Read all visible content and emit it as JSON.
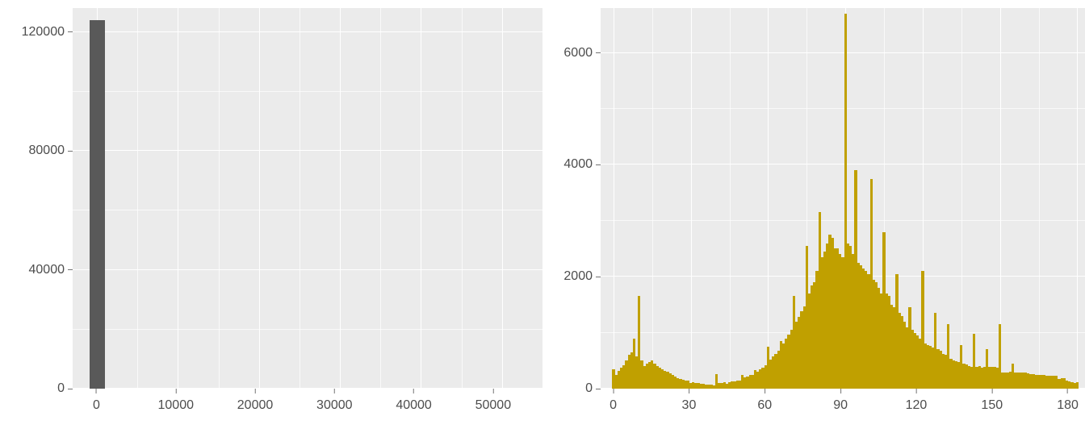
{
  "chart_data": [
    {
      "type": "bar",
      "title": "",
      "xlabel": "",
      "ylabel": "",
      "xlim": [
        -3000,
        55000
      ],
      "ylim": [
        0,
        128000
      ],
      "x_ticks": [
        0,
        10000,
        20000,
        30000,
        40000,
        50000
      ],
      "y_ticks": [
        0,
        40000,
        80000,
        120000
      ],
      "binwidth": 1900,
      "color": "#595959",
      "categories": [
        0
      ],
      "values": [
        124000
      ]
    },
    {
      "type": "bar",
      "title": "",
      "xlabel": "",
      "ylabel": "",
      "xlim": [
        -5,
        183
      ],
      "ylim": [
        0,
        6800
      ],
      "x_ticks": [
        0,
        30,
        60,
        90,
        120,
        150,
        180
      ],
      "y_ticks": [
        0,
        2000,
        4000,
        6000
      ],
      "binwidth": 1,
      "color": "#c0a000",
      "x": [
        0,
        1,
        2,
        3,
        4,
        5,
        6,
        7,
        8,
        9,
        10,
        11,
        12,
        13,
        14,
        15,
        16,
        17,
        18,
        19,
        20,
        21,
        22,
        23,
        24,
        25,
        26,
        27,
        28,
        29,
        30,
        31,
        32,
        33,
        34,
        35,
        36,
        37,
        38,
        39,
        40,
        41,
        42,
        43,
        44,
        45,
        46,
        47,
        48,
        49,
        50,
        51,
        52,
        53,
        54,
        55,
        56,
        57,
        58,
        59,
        60,
        61,
        62,
        63,
        64,
        65,
        66,
        67,
        68,
        69,
        70,
        71,
        72,
        73,
        74,
        75,
        76,
        77,
        78,
        79,
        80,
        81,
        82,
        83,
        84,
        85,
        86,
        87,
        88,
        89,
        90,
        91,
        92,
        93,
        94,
        95,
        96,
        97,
        98,
        99,
        100,
        101,
        102,
        103,
        104,
        105,
        106,
        107,
        108,
        109,
        110,
        111,
        112,
        113,
        114,
        115,
        116,
        117,
        118,
        119,
        120,
        121,
        122,
        123,
        124,
        125,
        126,
        127,
        128,
        129,
        130,
        131,
        132,
        133,
        134,
        135,
        136,
        137,
        138,
        139,
        140,
        141,
        142,
        143,
        144,
        145,
        146,
        147,
        148,
        149,
        150,
        151,
        152,
        153,
        154,
        155,
        156,
        157,
        158,
        159,
        160,
        161,
        162,
        163,
        164,
        165,
        166,
        167,
        168,
        169,
        170,
        171,
        172,
        173,
        174,
        175,
        176,
        177,
        178,
        179,
        180
      ],
      "values": [
        350,
        250,
        320,
        380,
        420,
        500,
        600,
        650,
        900,
        580,
        1650,
        500,
        400,
        450,
        480,
        500,
        450,
        400,
        380,
        350,
        320,
        300,
        280,
        240,
        210,
        190,
        180,
        160,
        150,
        140,
        100,
        110,
        105,
        95,
        90,
        80,
        70,
        75,
        70,
        65,
        260,
        100,
        105,
        110,
        90,
        120,
        125,
        130,
        140,
        150,
        250,
        200,
        220,
        240,
        250,
        330,
        300,
        350,
        380,
        420,
        750,
        520,
        580,
        620,
        680,
        850,
        800,
        900,
        960,
        1050,
        1650,
        1200,
        1280,
        1380,
        1470,
        2550,
        1700,
        1850,
        1900,
        2100,
        3150,
        2350,
        2450,
        2600,
        2750,
        2700,
        2500,
        2500,
        2400,
        2350,
        6700,
        2600,
        2550,
        2400,
        3900,
        2250,
        2200,
        2150,
        2100,
        2050,
        3750,
        1950,
        1900,
        1800,
        1700,
        2800,
        1700,
        1650,
        1500,
        1450,
        2050,
        1350,
        1300,
        1200,
        1100,
        1450,
        1050,
        1000,
        950,
        900,
        2100,
        800,
        780,
        760,
        730,
        1350,
        700,
        680,
        620,
        600,
        1150,
        530,
        510,
        490,
        480,
        780,
        450,
        430,
        400,
        390,
        980,
        390,
        400,
        380,
        385,
        700,
        395,
        390,
        385,
        380,
        1150,
        285,
        295,
        290,
        305,
        450,
        290,
        290,
        290,
        290,
        290,
        270,
        260,
        255,
        250,
        250,
        245,
        240,
        235,
        230,
        230,
        230,
        230,
        180,
        190,
        190,
        140,
        130,
        120,
        100,
        120
      ]
    }
  ],
  "left": {
    "x_ticks": [
      "0",
      "10000",
      "20000",
      "30000",
      "40000",
      "50000"
    ],
    "y_ticks": [
      "0",
      "40000",
      "80000",
      "120000"
    ]
  },
  "right": {
    "x_ticks": [
      "0",
      "30",
      "60",
      "90",
      "120",
      "150",
      "180"
    ],
    "y_ticks": [
      "0",
      "2000",
      "4000",
      "6000"
    ]
  },
  "colors": {
    "panel_bg": "#ebebeb",
    "grid": "#ffffff",
    "axis_text": "#4d4d4d",
    "bar_left": "#595959",
    "bar_right": "#c0a000"
  }
}
